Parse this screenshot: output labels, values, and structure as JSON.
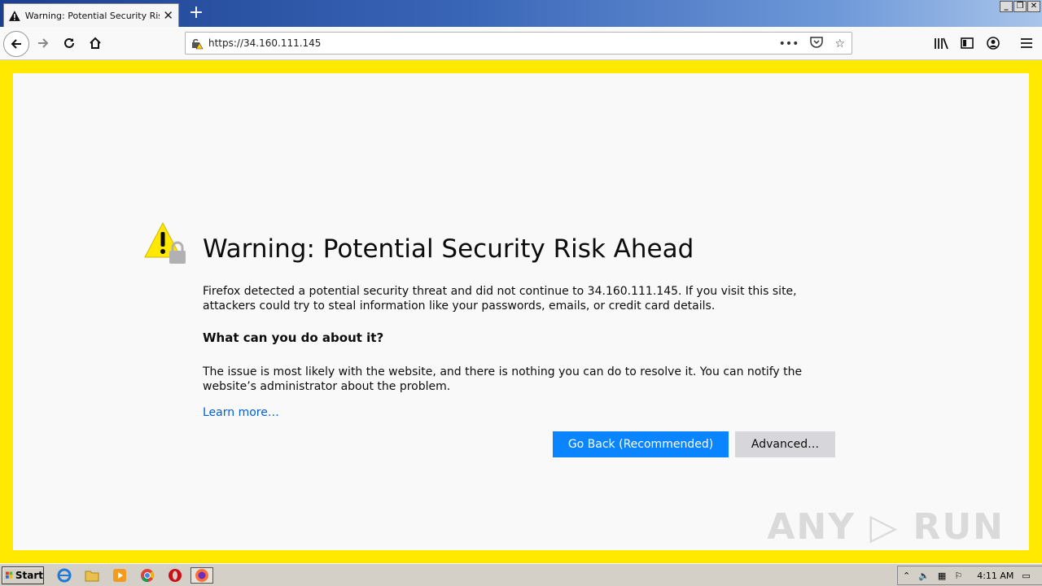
{
  "browser": {
    "tab_title": "Warning: Potential Security Risk Ahead",
    "url": "https://34.160.111.145"
  },
  "page": {
    "heading": "Warning: Potential Security Risk Ahead",
    "intro": "Firefox detected a potential security threat and did not continue to 34.160.111.145. If you visit this site, attackers could try to steal information like your passwords, emails, or credit card details.",
    "subheading": "What can you do about it?",
    "advice": "The issue is most likely with the website, and there is nothing you can do to resolve it. You can notify the website’s administrator about the problem.",
    "learn_more": "Learn more…",
    "go_back_label": "Go Back (Recommended)",
    "advanced_label": "Advanced…"
  },
  "watermark": "ANY ▷ RUN",
  "taskbar": {
    "start_label": "Start",
    "clock": "4:11 AM"
  },
  "colors": {
    "frame_border": "#ffe900",
    "primary_button": "#0a84ff",
    "link": "#0060df"
  }
}
